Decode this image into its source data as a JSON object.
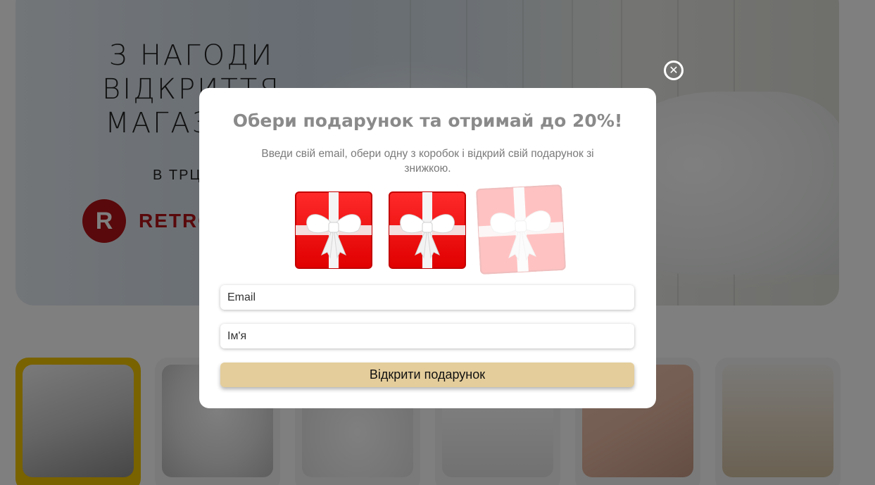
{
  "hero": {
    "title_lines": [
      "З НАГОДИ",
      "ВІДКРИТТЯ",
      "МАГАЗИНУ"
    ],
    "subtitle": "В ТРЦ",
    "logo_letter": "R",
    "logo_text": "RETRO"
  },
  "categories": [
    {
      "name": "pillows-stack",
      "active": true
    },
    {
      "name": "duvet"
    },
    {
      "name": "pillow"
    },
    {
      "name": "mattress-topper"
    },
    {
      "name": "bed-linen"
    },
    {
      "name": "bathrobe"
    }
  ],
  "popup": {
    "close_symbol": "✕",
    "title": "Обери подарунок та отримай до 20%!",
    "description": "Введи свій email, обери одну з коробок і відкрий свій подарунок зі знижкою.",
    "email_placeholder": "Email",
    "name_placeholder": "Ім'я",
    "submit_label": "Відкрити подарунок",
    "gift_icons": [
      "gift-box-icon",
      "gift-box-icon",
      "gift-box-icon"
    ]
  },
  "colors": {
    "gift_red": "#ff1111",
    "ribbon": "#f3f3f3",
    "submit_bg": "#e4cd9b",
    "active_category": "#f2c400",
    "brand_red": "#b31217"
  }
}
